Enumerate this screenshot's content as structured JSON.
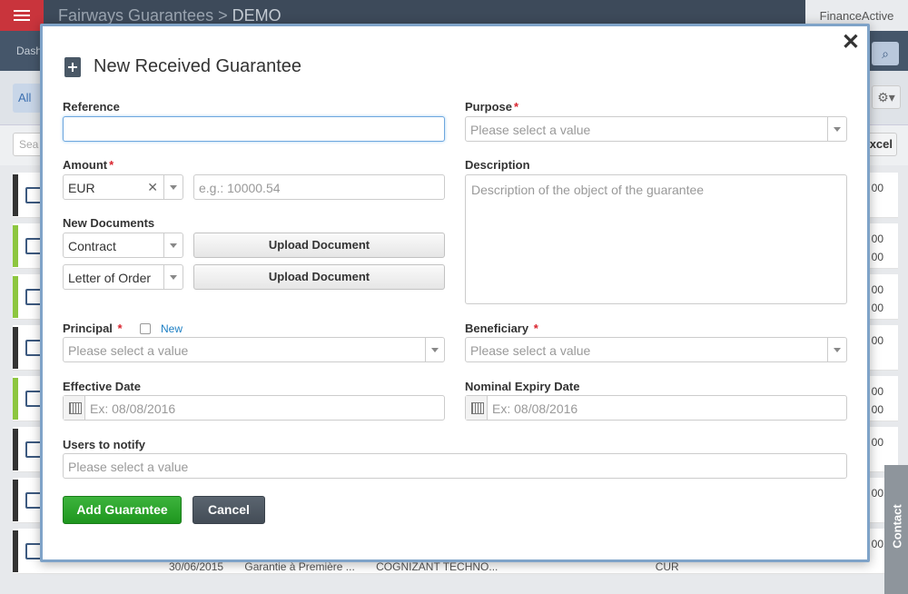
{
  "app": {
    "title": "Fairways Guarantees",
    "separator": ">",
    "context": "DEMO",
    "brand": "FinanceActive",
    "nav_first": "Dash",
    "all_label": "All",
    "search_partial": "Sea",
    "excel_label": "xcel",
    "contact_tab": "Contact"
  },
  "background_rows": {
    "values": [
      "00",
      "00",
      "00",
      "00",
      "00",
      "00",
      "00",
      "00",
      "00",
      "00",
      "00",
      "00"
    ],
    "bar_colors": [
      "#333333",
      "#8dc63f",
      "#8dc63f",
      "#333333",
      "#8dc63f",
      "#333333",
      "#333333",
      "#333333"
    ],
    "last_row": {
      "date": "30/06/2015",
      "type": "Garantie à Première ...",
      "company": "COGNIZANT TECHNO...",
      "currency": "CUR"
    }
  },
  "modal": {
    "title": "New Received Guarantee",
    "close_symbol": "✕",
    "reference": {
      "label": "Reference",
      "value": ""
    },
    "purpose": {
      "label": "Purpose",
      "placeholder": "Please select a value"
    },
    "amount": {
      "label": "Amount",
      "currency": "EUR",
      "clear_symbol": "✕",
      "placeholder": "e.g.: 10000.54"
    },
    "description": {
      "label": "Description",
      "placeholder": "Description of the object of the guarantee"
    },
    "new_documents": {
      "label": "New Documents",
      "rows": [
        {
          "type": "Contract",
          "button": "Upload Document"
        },
        {
          "type": "Letter of Order",
          "button": "Upload Document"
        }
      ]
    },
    "principal": {
      "label": "Principal",
      "new_link": "New",
      "placeholder": "Please select a value"
    },
    "beneficiary": {
      "label": "Beneficiary",
      "placeholder": "Please select a value"
    },
    "effective_date": {
      "label": "Effective Date",
      "placeholder": "Ex: 08/08/2016"
    },
    "nominal_expiry_date": {
      "label": "Nominal Expiry Date",
      "placeholder": "Ex: 08/08/2016"
    },
    "users_to_notify": {
      "label": "Users to notify",
      "placeholder": "Please select a value"
    },
    "required_marker": "*",
    "buttons": {
      "add": "Add Guarantee",
      "cancel": "Cancel"
    }
  }
}
